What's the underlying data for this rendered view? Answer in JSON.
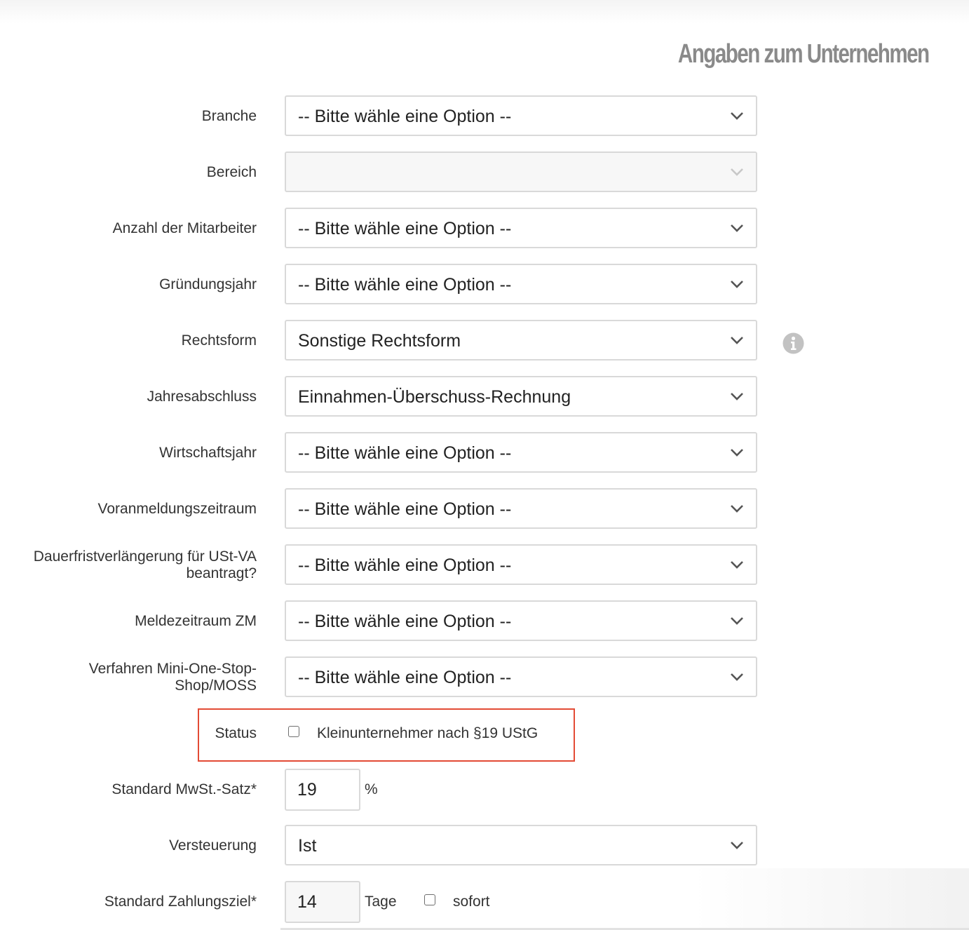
{
  "page": {
    "title": "Angaben zum Unternehmen"
  },
  "placeholder_option": "-- Bitte wähle eine Option --",
  "fields": {
    "branche": {
      "label": "Branche",
      "value": "-- Bitte wähle eine Option --"
    },
    "bereich": {
      "label": "Bereich",
      "value": ""
    },
    "mitarbeiter": {
      "label": "Anzahl der Mitarbeiter",
      "value": "-- Bitte wähle eine Option --"
    },
    "gruendungsjahr": {
      "label": "Gründungsjahr",
      "value": "-- Bitte wähle eine Option --"
    },
    "rechtsform": {
      "label": "Rechtsform",
      "value": "Sonstige Rechtsform"
    },
    "jahresabschluss": {
      "label": "Jahresabschluss",
      "value": "Einnahmen-Überschuss-Rechnung"
    },
    "wirtschaftsjahr": {
      "label": "Wirtschaftsjahr",
      "value": "-- Bitte wähle eine Option --"
    },
    "voranmeldungszeitraum": {
      "label": "Voranmeldungszeitraum",
      "value": "-- Bitte wähle eine Option --"
    },
    "dauerfrist": {
      "label_line1": "Dauerfristverlängerung für USt-VA",
      "label_line2": "beantragt?",
      "value": "-- Bitte wähle eine Option --"
    },
    "meldezeitraum_zm": {
      "label": "Meldezeitraum ZM",
      "value": "-- Bitte wähle eine Option --"
    },
    "moss": {
      "label_line1": "Verfahren Mini-One-Stop-",
      "label_line2": "Shop/MOSS",
      "value": "-- Bitte wähle eine Option --"
    },
    "status": {
      "label": "Status",
      "checkbox_label": "Kleinunternehmer nach §19 UStG",
      "checked": false
    },
    "mwst": {
      "label": "Standard MwSt.-Satz*",
      "value": "19",
      "unit": "%"
    },
    "versteuerung": {
      "label": "Versteuerung",
      "value": "Ist"
    },
    "zahlungsziel": {
      "label": "Standard Zahlungsziel*",
      "value": "14",
      "unit": "Tage",
      "sofort_label": "sofort",
      "sofort_checked": false
    }
  },
  "icons": {
    "select_arrow": "chevron-down-icon",
    "rechtsform_help": "info-icon"
  },
  "colors": {
    "highlight_border": "#e34b35",
    "title": "#8a8a8a",
    "field_border": "#d9d9d9"
  }
}
